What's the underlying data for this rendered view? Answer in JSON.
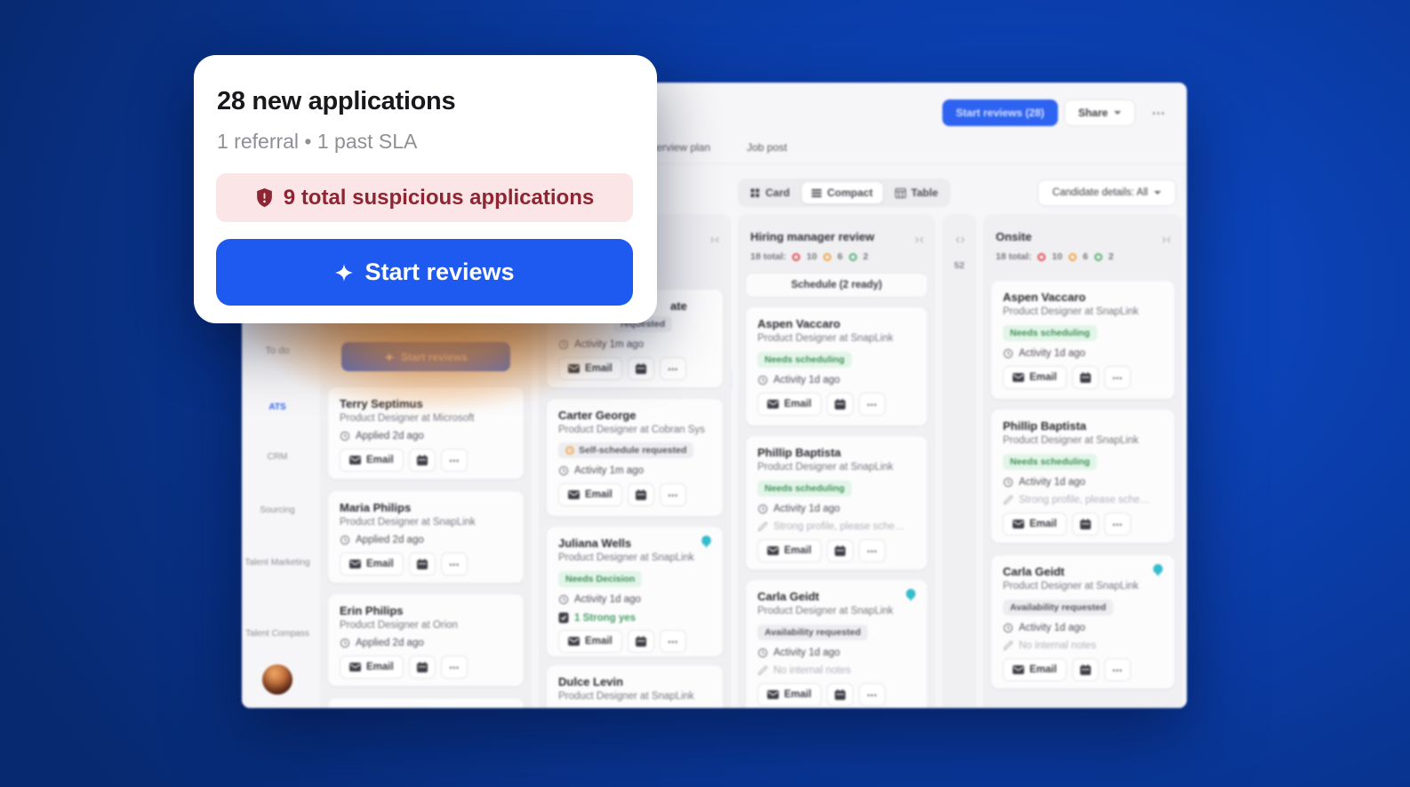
{
  "colors": {
    "accent_blue": "#1f5af0",
    "alert_red": "#8d2533",
    "alert_bg": "#fbe5e6",
    "glow_orange": "#f4983a",
    "badge_green": "#41915a",
    "balloon_teal": "#35bccc",
    "background_blue_dark": "#07296f",
    "background_blue_bright": "#0d4ac9"
  },
  "popup": {
    "title": "28 new applications",
    "subtitle": "1 referral • 1 past SLA",
    "alert_text": "9 total suspicious applications",
    "alert_icon": "shield-exclamation-icon",
    "cta_label": "Start reviews",
    "cta_icon": "sparkle-icon"
  },
  "app": {
    "labels": {
      "email": "Email",
      "more": "⋯"
    },
    "header": {
      "start_reviews_button": "Start reviews (28)",
      "share_button": "Share"
    },
    "tabs": {
      "tab_interview_plan": "terview plan",
      "tab_job_post": "Job post"
    },
    "toolbar": {
      "view_card": "Card",
      "view_compact": "Compact",
      "view_table": "Table",
      "details_filter": "Candidate details: All"
    },
    "sidebar": {
      "section": "To do",
      "ats": "ATS",
      "crm": "CRM",
      "sourcing": "Sourcing",
      "talent_marketing": "Talent Marketing",
      "talent_compass": "Talent Compass"
    },
    "board": {
      "col_new": {
        "cta": "Start reviews",
        "cards": [
          {
            "name": "Terry Septimus",
            "role": "Product Designer at Microsoft",
            "activity": "Applied 2d ago"
          },
          {
            "name": "Maria Philips",
            "role": "Product Designer at SnapLink",
            "activity": "Applied 2d ago"
          },
          {
            "name": "Erin Philips",
            "role": "Product Designer at Orion",
            "activity": "Applied 2d ago"
          }
        ]
      },
      "col_review": {
        "cards": [
          {
            "name_fragment": "ate",
            "badge_fragment": "requested",
            "activity": "Activity 1m ago"
          },
          {
            "name": "Carter George",
            "role": "Product Designer at Cobran Sys",
            "badge": "Self-schedule requested",
            "activity": "Activity 1m ago"
          },
          {
            "name": "Juliana Wells",
            "role": "Product Designer at SnapLink",
            "badge": "Needs Decision",
            "activity": "Activity 1d ago",
            "note": "1 Strong yes"
          },
          {
            "name": "Dulce Levin",
            "role": "Product Designer at SnapLink"
          }
        ]
      },
      "col_hm": {
        "title": "Hiring manager review",
        "total": "18 total:",
        "count_red": "10",
        "count_orange": "6",
        "count_green": "2",
        "schedule_button": "Schedule (2 ready)",
        "cards": [
          {
            "name": "Aspen Vaccaro",
            "role": "Product Designer at SnapLink",
            "badge": "Needs scheduling",
            "activity": "Activity 1d ago"
          },
          {
            "name": "Phillip Baptista",
            "role": "Product Designer at SnapLink",
            "badge": "Needs scheduling",
            "activity": "Activity 1d ago",
            "note": "Strong profile, please sche…"
          },
          {
            "name": "Carla Geidt",
            "role": "Product Designer at SnapLink",
            "badge": "Availability requested",
            "activity": "Activity 1d ago",
            "note": "No internal notes"
          }
        ]
      },
      "col_collapsed": {
        "count": "52"
      },
      "col_onsite": {
        "title": "Onsite",
        "total": "18 total:",
        "count_red": "10",
        "count_orange": "6",
        "count_green": "2",
        "cards": [
          {
            "name": "Aspen Vaccaro",
            "role": "Product Designer at SnapLink",
            "badge": "Needs scheduling",
            "activity": "Activity 1d ago"
          },
          {
            "name": "Phillip Baptista",
            "role": "Product Designer at SnapLink",
            "badge": "Needs scheduling",
            "activity": "Activity 1d ago",
            "note": "Strong profile, please sche…"
          },
          {
            "name": "Carla Geidt",
            "role": "Product Designer at SnapLink",
            "badge": "Availability requested",
            "activity": "Activity 1d ago",
            "note": "No internal notes"
          }
        ]
      }
    }
  }
}
